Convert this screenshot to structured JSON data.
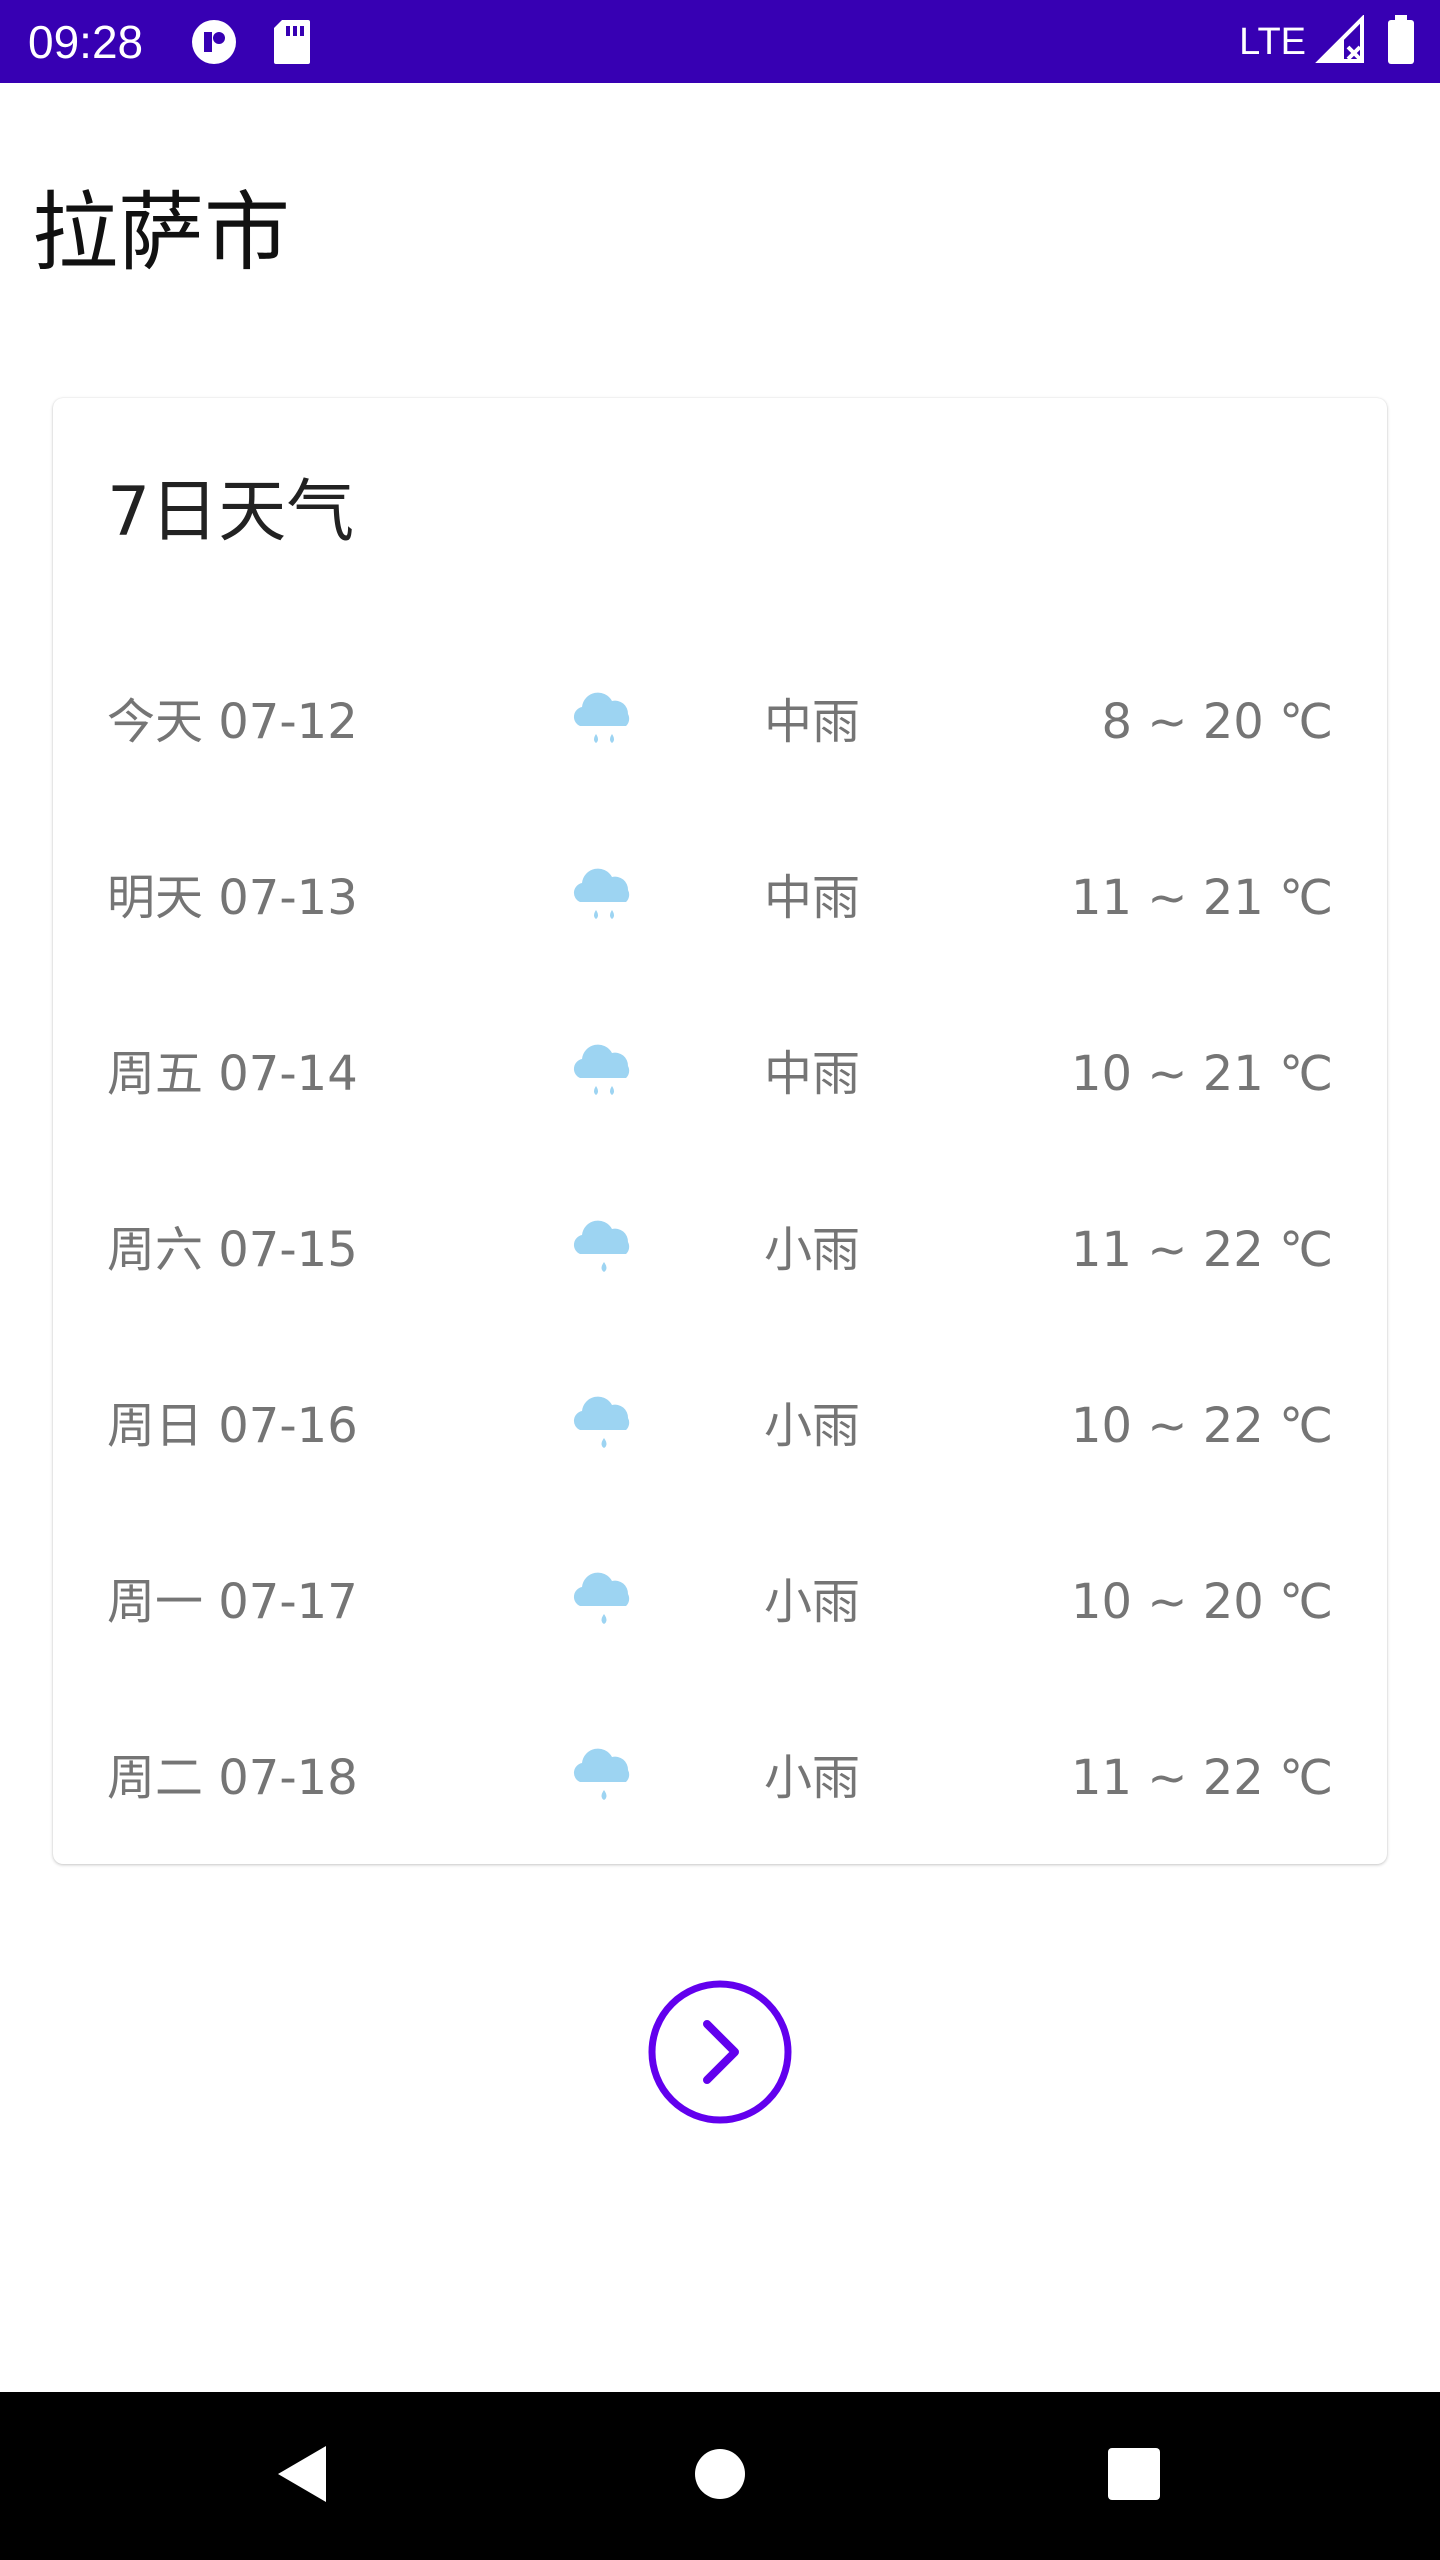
{
  "status_bar": {
    "time": "09:28",
    "network": "LTE",
    "background_color": "#3700b3",
    "icons": [
      "notification-app-icon",
      "sd-card-icon",
      "signal-icon",
      "battery-icon"
    ]
  },
  "city": "拉萨市",
  "forecast": {
    "title": "7日天气",
    "days": [
      {
        "date": "今天 07-12",
        "icon": "moderate-rain-icon",
        "condition": "中雨",
        "temp": "8 ~ 20 ℃"
      },
      {
        "date": "明天 07-13",
        "icon": "moderate-rain-icon",
        "condition": "中雨",
        "temp": "11 ~ 21 ℃"
      },
      {
        "date": "周五 07-14",
        "icon": "moderate-rain-icon",
        "condition": "中雨",
        "temp": "10 ~ 21 ℃"
      },
      {
        "date": "周六 07-15",
        "icon": "light-rain-icon",
        "condition": "小雨",
        "temp": "11 ~ 22 ℃"
      },
      {
        "date": "周日 07-16",
        "icon": "light-rain-icon",
        "condition": "小雨",
        "temp": "10 ~ 22 ℃"
      },
      {
        "date": "周一 07-17",
        "icon": "light-rain-icon",
        "condition": "小雨",
        "temp": "10 ~ 20 ℃"
      },
      {
        "date": "周二 07-18",
        "icon": "light-rain-icon",
        "condition": "小雨",
        "temp": "11 ~ 22 ℃"
      }
    ]
  },
  "next_button": {
    "icon": "chevron-right-circle-icon",
    "color": "#6200ee"
  },
  "nav_bar": {
    "icons": [
      "back-icon",
      "home-icon",
      "recents-icon"
    ]
  },
  "colors": {
    "weather_icon": "#9dd4f2",
    "secondary_text": "#757575",
    "accent": "#6200ee"
  }
}
